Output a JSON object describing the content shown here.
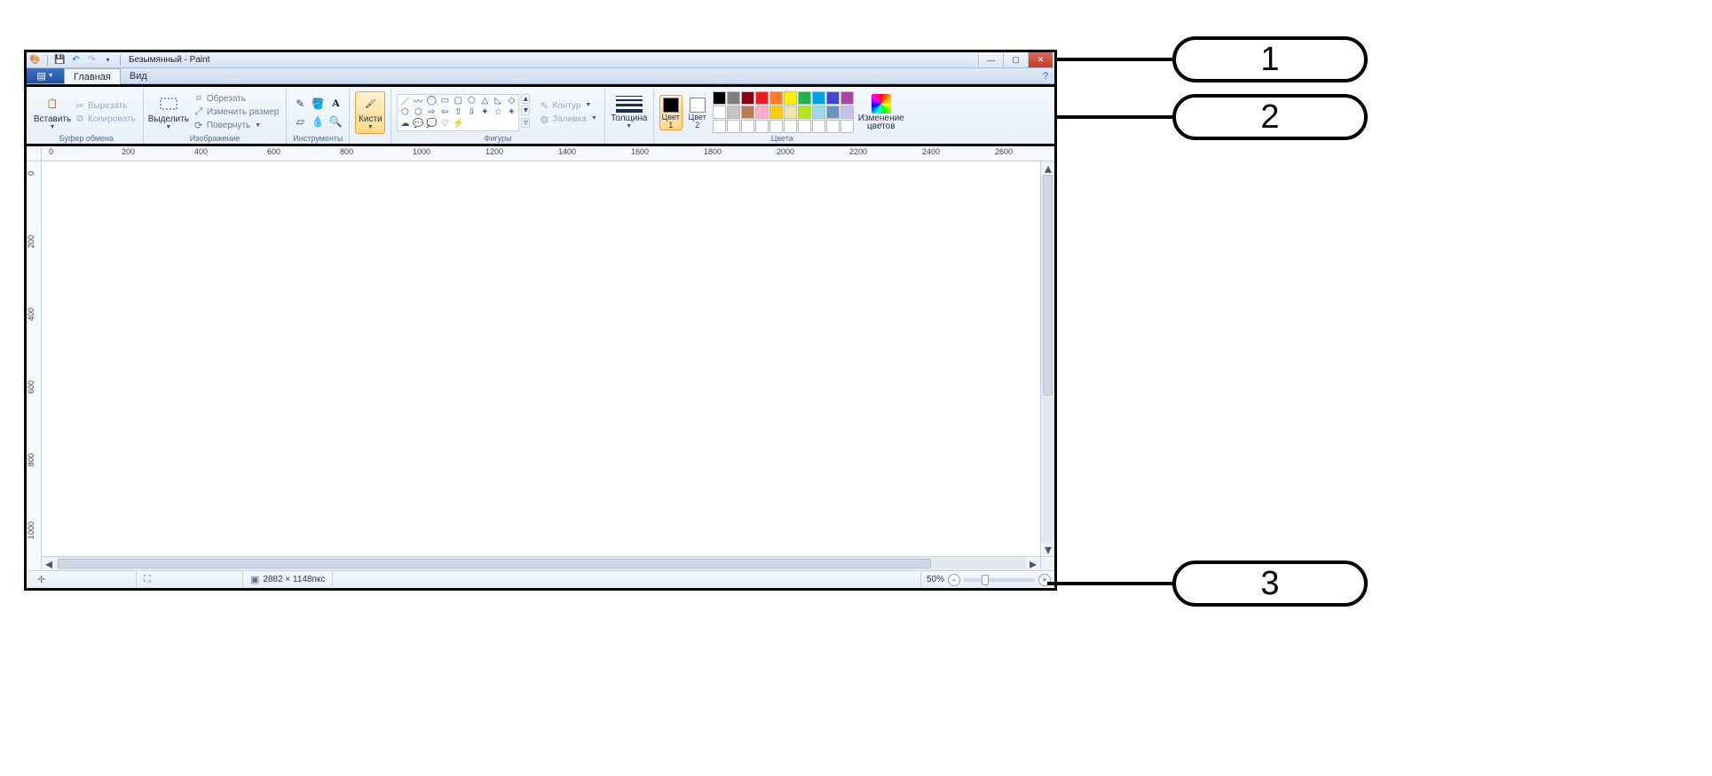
{
  "title": "Безымянный - Paint",
  "tabs": {
    "home": "Главная",
    "view": "Вид"
  },
  "ribbon": {
    "clipboard": {
      "paste": "Вставить",
      "cut": "Вырезать",
      "copy": "Копировать",
      "group": "Буфер обмена"
    },
    "image": {
      "select": "Выделить",
      "crop": "Обрезать",
      "resize": "Изменить размер",
      "rotate": "Повернуть",
      "group": "Изображение"
    },
    "tools": {
      "group": "Инструменты"
    },
    "brushes": {
      "label": "Кисти"
    },
    "shapes": {
      "outline": "Контур",
      "fill": "Заливка",
      "group": "Фигуры"
    },
    "size": {
      "label": "Толщина"
    },
    "colors": {
      "c1": "Цвет\n1",
      "c2": "Цвет\n2",
      "edit": "Изменение\nцветов",
      "group": "Цвета"
    }
  },
  "palette_row1": [
    "#000000",
    "#7f7f7f",
    "#880015",
    "#ed1c24",
    "#ff7f27",
    "#fff200",
    "#22b14c",
    "#00a2e8",
    "#3f48cc",
    "#a349a4"
  ],
  "palette_row2": [
    "#ffffff",
    "#c3c3c3",
    "#b97a57",
    "#ffaec9",
    "#ffc90e",
    "#efe4b0",
    "#b5e61d",
    "#99d9ea",
    "#7092be",
    "#c8bfe7"
  ],
  "palette_row3": [
    "#ffffff",
    "#ffffff",
    "#ffffff",
    "#ffffff",
    "#ffffff",
    "#ffffff",
    "#ffffff",
    "#ffffff",
    "#ffffff",
    "#ffffff"
  ],
  "ruler_h": [
    "0",
    "200",
    "400",
    "600",
    "800",
    "1000",
    "1200",
    "1400",
    "1600",
    "1800",
    "2000",
    "2200",
    "2400",
    "2600"
  ],
  "ruler_v": [
    "0",
    "200",
    "400",
    "600",
    "800",
    "1000"
  ],
  "status": {
    "dimensions": "2882 × 1148пкс",
    "zoom": "50%"
  },
  "callouts": {
    "c1": "1",
    "c2": "2",
    "c3": "3"
  }
}
